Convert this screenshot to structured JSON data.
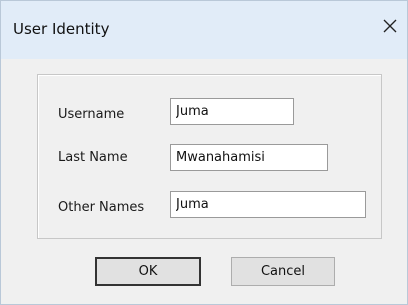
{
  "window": {
    "title": "User Identity",
    "close_icon": "close-icon"
  },
  "form": {
    "fields": [
      {
        "label": "Username",
        "value": "Juma"
      },
      {
        "label": "Last Name",
        "value": "Mwanahamisi"
      },
      {
        "label": "Other Names",
        "value": "Juma"
      }
    ]
  },
  "buttons": {
    "ok_label": "OK",
    "cancel_label": "Cancel"
  }
}
